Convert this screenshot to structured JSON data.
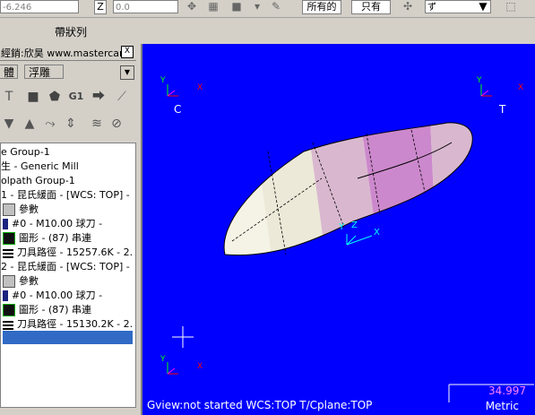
{
  "toolbar": {
    "coord_value": "-6.246",
    "z_label": "Z",
    "z_value": "0.0",
    "all_button": "所有的",
    "only_button": "只有",
    "dropdown_value": "ず"
  },
  "ribbon": {
    "label": "帶狀列"
  },
  "panel": {
    "title": "經銷:欣昊 www.mastercam.",
    "close": "X",
    "tabs": [
      "體",
      "浮雕"
    ],
    "dropdown_arrow": "▼",
    "tree": [
      "e Group-1",
      "生 - Generic Mill",
      "olpath Group-1",
      " 1 - 昆氏緩面 - [WCS: TOP] -",
      "參數",
      "#0 - M10.00 球刀 -",
      "圖形 - (87) 串連",
      "刀具路徑 - 15257.6K - 2.",
      " 2 - 昆氏緩面 - [WCS: TOP] -",
      "參數",
      "#0 - M10.00 球刀 -",
      "圖形 - (87) 串連",
      "刀具路徑 - 15130.2K - 2."
    ]
  },
  "viewport": {
    "label_c": "C",
    "label_t": "T",
    "axis_y": "Y",
    "axis_x": "X",
    "axis_z": "Z",
    "status_text": "Gview:not started   WCS:TOP   T/Cplane:TOP",
    "scale_value": "34.997",
    "scale_unit": "Metric"
  },
  "colors": {
    "viewport_bg": "#0000ff",
    "panel_bg": "#d4d0c8",
    "selection": "#316ac5"
  }
}
